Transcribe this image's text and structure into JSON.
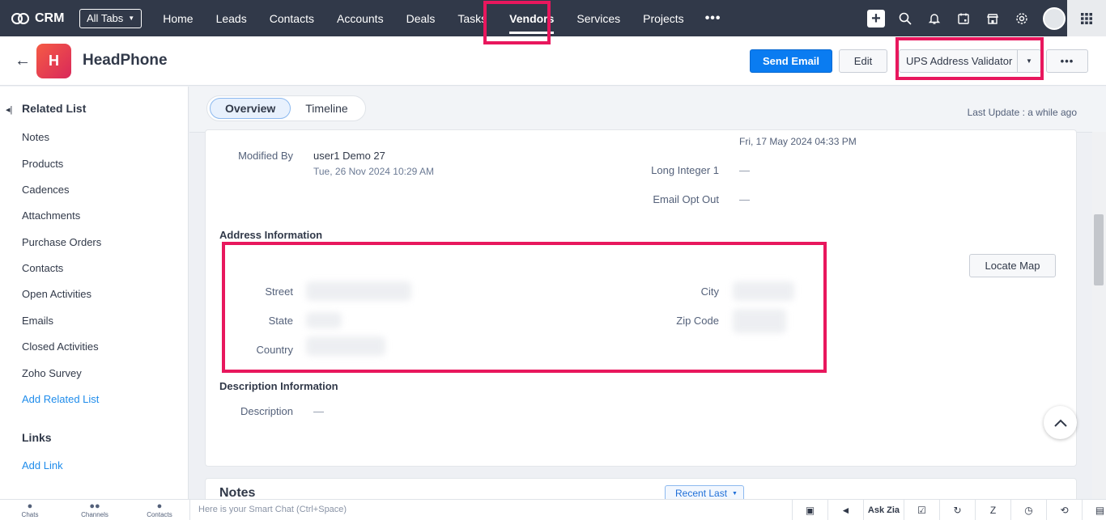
{
  "topnav": {
    "brand": "CRM",
    "all_tabs": "All Tabs",
    "tabs": [
      "Home",
      "Leads",
      "Contacts",
      "Accounts",
      "Deals",
      "Tasks",
      "Vendors",
      "Services",
      "Projects"
    ],
    "active_tab": "Vendors",
    "more": "•••"
  },
  "record": {
    "avatar_letter": "H",
    "title": "HeadPhone",
    "send_email": "Send Email",
    "edit": "Edit",
    "ups": "UPS Address Validator",
    "more": "•••"
  },
  "sidebar": {
    "related_heading": "Related List",
    "items": [
      "Notes",
      "Products",
      "Cadences",
      "Attachments",
      "Purchase Orders",
      "Contacts",
      "Open Activities",
      "Emails",
      "Closed Activities",
      "Zoho Survey"
    ],
    "add_related": "Add Related List",
    "links_heading": "Links",
    "add_link": "Add Link"
  },
  "view_tabs": {
    "overview": "Overview",
    "timeline": "Timeline",
    "last_update": "Last Update : a while ago"
  },
  "details": {
    "modified_by_label": "Modified By",
    "modified_by_user": "user1 Demo 27",
    "modified_by_time": "Tue, 26 Nov 2024 10:29 AM",
    "created_time_value": "Fri, 17 May 2024 04:33 PM",
    "long_integer_label": "Long Integer 1",
    "long_integer_value": "—",
    "email_opt_out_label": "Email Opt Out",
    "email_opt_out_value": "—"
  },
  "address": {
    "heading": "Address Information",
    "street_label": "Street",
    "city_label": "City",
    "state_label": "State",
    "zip_label": "Zip Code",
    "country_label": "Country",
    "locate_map": "Locate Map"
  },
  "description": {
    "heading": "Description Information",
    "label": "Description",
    "value": "—"
  },
  "notes": {
    "heading": "Notes",
    "sort": "Recent Last"
  },
  "bottombar": {
    "chats": "Chats",
    "channels": "Channels",
    "contacts": "Contacts",
    "smart_chat_placeholder": "Here is your Smart Chat (Ctrl+Space)",
    "ask_zia": "Ask Zia"
  },
  "colors": {
    "nav_bg": "#313949",
    "primary": "#0a7cf1",
    "highlight": "#e8175d",
    "link": "#1f8ceb"
  }
}
